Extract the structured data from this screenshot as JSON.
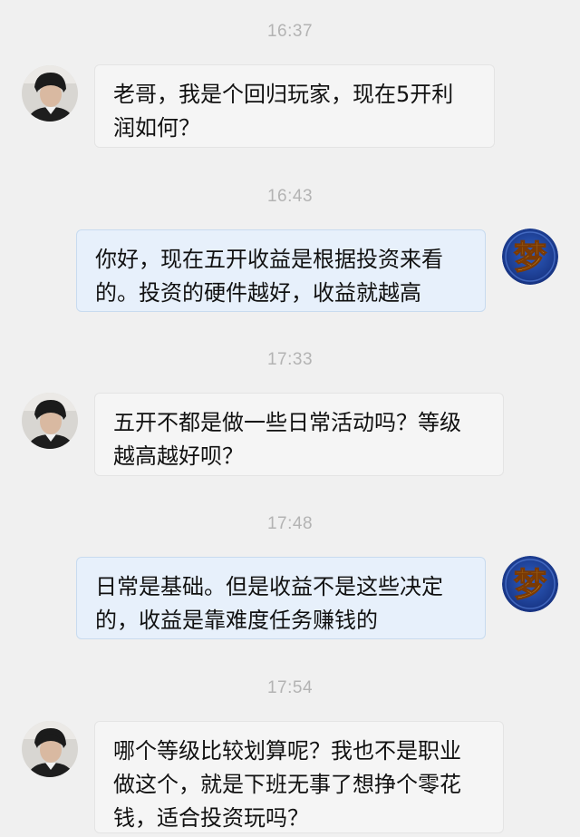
{
  "chat": {
    "messages": [
      {
        "time": "16:37",
        "from": "user",
        "text": "老哥，我是个回归玩家，现在5开利\n润如何？"
      },
      {
        "time": "16:43",
        "from": "agent",
        "text": "你好，现在五开收益是根据投资来看\n的。投资的硬件越好，收益就越高"
      },
      {
        "time": "17:33",
        "from": "user",
        "text": "五开不都是做一些日常活动吗？等级\n越高越好呗？"
      },
      {
        "time": "17:48",
        "from": "agent",
        "text": "日常是基础。但是收益不是这些决定\n的，收益是靠难度任务赚钱的"
      },
      {
        "time": "17:54",
        "from": "user",
        "text": "哪个等级比较划算呢？我也不是职业\n做这个，就是下班无事了想挣个零花\n钱，适合投资玩吗？"
      }
    ]
  },
  "avatars": {
    "agent_glyph": "梦"
  },
  "colors": {
    "background": "#f0f0f0",
    "incoming_bubble": "#f5f5f5",
    "outgoing_bubble": "#e7f0fb",
    "timestamp": "#b3b3b3",
    "agent_avatar_bg": "#1b3f9a",
    "agent_avatar_glyph": "#f6c33a"
  }
}
